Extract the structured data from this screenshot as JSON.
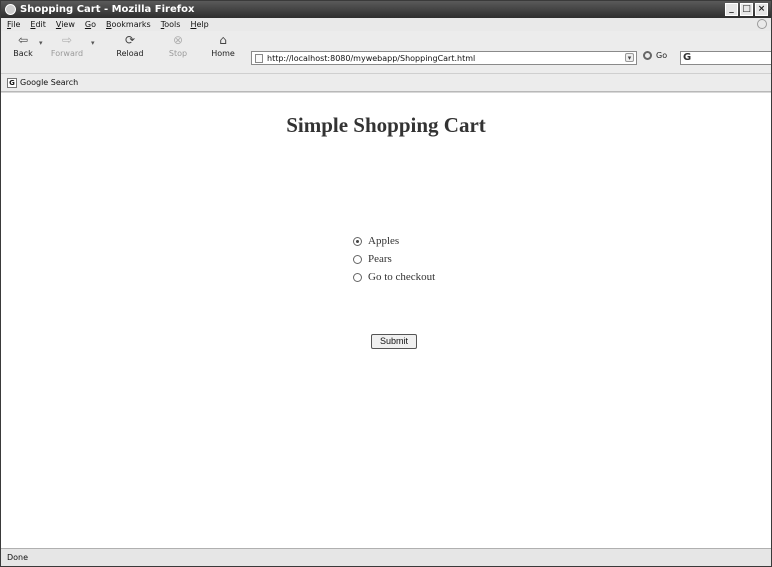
{
  "window": {
    "title": "Shopping Cart - Mozilla Firefox"
  },
  "menubar": [
    {
      "label": "File",
      "key": "F"
    },
    {
      "label": "Edit",
      "key": "E"
    },
    {
      "label": "View",
      "key": "V"
    },
    {
      "label": "Go",
      "key": "G"
    },
    {
      "label": "Bookmarks",
      "key": "B"
    },
    {
      "label": "Tools",
      "key": "T"
    },
    {
      "label": "Help",
      "key": "H"
    }
  ],
  "toolbar": {
    "back": "Back",
    "forward": "Forward",
    "reload": "Reload",
    "stop": "Stop",
    "home": "Home",
    "url": "http://localhost:8080/mywebapp/ShoppingCart.html",
    "go": "Go"
  },
  "bookmarks": {
    "google_search": "Google Search"
  },
  "page": {
    "title": "Simple Shopping Cart",
    "options": [
      {
        "label": "Apples",
        "checked": true
      },
      {
        "label": "Pears",
        "checked": false
      },
      {
        "label": "Go to checkout",
        "checked": false
      }
    ],
    "submit": "Submit"
  },
  "status": "Done"
}
